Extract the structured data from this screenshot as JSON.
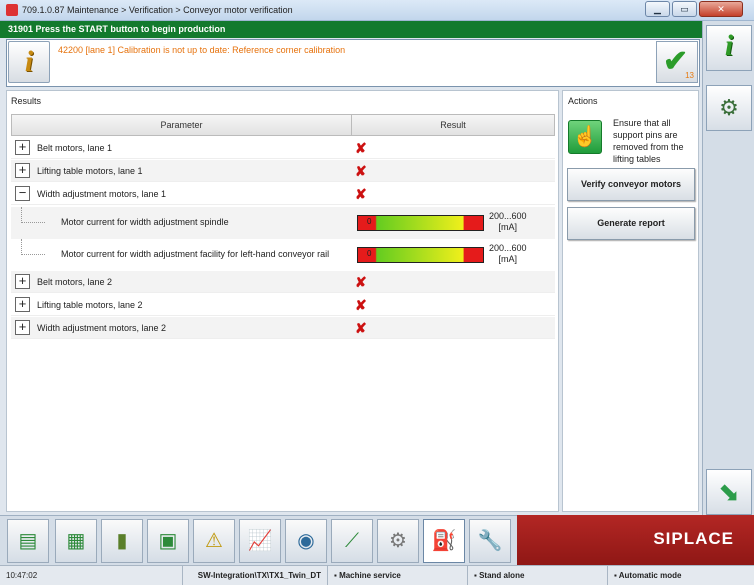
{
  "window": {
    "title": "709.1.0.87 Maintenance > Verification > Conveyor motor verification"
  },
  "banner": {
    "text": "31901 Press the START button to begin production"
  },
  "message": {
    "text": "42200 [lane 1] Calibration is not up to date: Reference corner calibration",
    "count": "13"
  },
  "results": {
    "header": "Results",
    "columns": {
      "parameter": "Parameter",
      "result": "Result"
    },
    "rows": [
      {
        "label": "Belt motors, lane 1",
        "toggle": "+"
      },
      {
        "label": "Lifting table motors, lane 1",
        "toggle": "+"
      },
      {
        "label": "Width adjustment motors, lane 1",
        "toggle": "−"
      },
      {
        "label": "Belt motors, lane 2",
        "toggle": "+"
      },
      {
        "label": "Lifting table motors, lane 2",
        "toggle": "+"
      },
      {
        "label": "Width adjustment motors, lane 2",
        "toggle": "+"
      }
    ],
    "subrows": [
      {
        "label": "Motor current for width adjustment spindle",
        "value": "0",
        "range": "200...600",
        "unit": "[mA]"
      },
      {
        "label": "Motor current for width adjustment facility for left-hand conveyor rail",
        "value": "0",
        "range": "200...600",
        "unit": "[mA]"
      }
    ]
  },
  "actions": {
    "header": "Actions",
    "hint": "Ensure that all support pins are removed from the lifting tables",
    "verify_label": "Verify conveyor motors",
    "report_label": "Generate report"
  },
  "brand": "SIPLACE",
  "status": {
    "time": "10:47:02",
    "station": "SW-Integration\\TX\\TX1_Twin_DT",
    "mode1": "Machine service",
    "mode2": "Stand alone",
    "mode3": "Automatic mode"
  },
  "colors": {
    "banner": "#137a2d",
    "message": "#e6720d",
    "fail": "#cc1111",
    "brand": "#b32724"
  },
  "icons": [
    "info-icon",
    "checkmark-icon",
    "close-icon",
    "maximize-icon",
    "minimize-icon",
    "gear-check-icon",
    "arrow-icon",
    "stack-icon",
    "table-icon",
    "bar-chart-icon",
    "board-icon",
    "warning-icon",
    "line-chart-icon",
    "camera-icon",
    "nozzle-icon",
    "hand-gear-icon",
    "oilcan-icon",
    "wrench-icon"
  ]
}
